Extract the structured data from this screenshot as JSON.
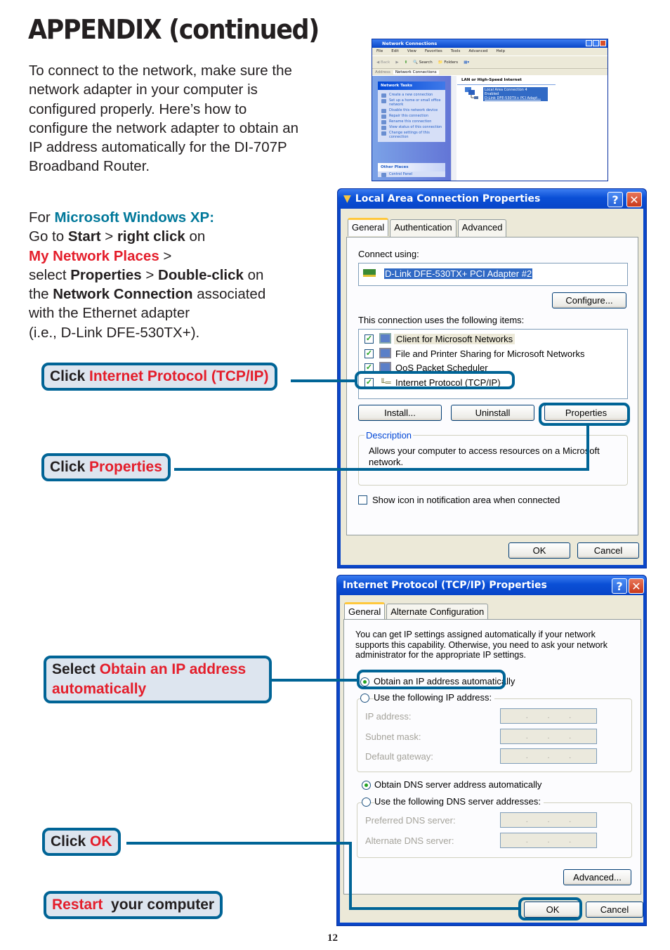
{
  "page": {
    "title": "APPENDIX  (continued)",
    "intro": "To connect to the network, make sure the network adapter in your computer is configured properly. Here’s how to configure the network adapter to obtain an IP address automatically for the DI-707P Broadband Router.",
    "page_number": "12"
  },
  "steps": {
    "for": "For ",
    "os": "Microsoft Windows XP:",
    "goto": "Go to ",
    "start": "Start",
    "gt1": " > ",
    "right_click": "right click",
    "on1": " on",
    "my_network_places": "My Network Places",
    "gt2": " >",
    "select": "select ",
    "properties": "Properties",
    "gt3": " > ",
    "double_click": "Double-click",
    "on2": " on",
    "the": "the ",
    "network_connection": "Network Connection",
    "associated": " associated",
    "with_adapter": "with the Ethernet adapter",
    "example": "(i.e., D-Link DFE-530TX+)."
  },
  "callouts": [
    {
      "prefix": "Click ",
      "highlight": "Internet Protocol (TCP/IP)"
    },
    {
      "prefix": "Click ",
      "highlight": "Properties"
    },
    {
      "prefix": "Select ",
      "highlight": "Obtain an IP address automatically"
    },
    {
      "prefix": "Click ",
      "highlight": "OK"
    },
    {
      "highlight": "Restart",
      "suffix": "  your computer"
    }
  ],
  "network_connections": {
    "title": "Network Connections",
    "menu": [
      "File",
      "Edit",
      "View",
      "Favorites",
      "Tools",
      "Advanced",
      "Help"
    ],
    "toolbar": {
      "back": "Back",
      "search": "Search",
      "folders": "Folders"
    },
    "address_label": "Address",
    "address_value": "Network Connections",
    "network_tasks_header": "Network Tasks",
    "network_tasks": [
      "Create a new connection",
      "Set up a home or small office network",
      "Disable this network device",
      "Repair this connection",
      "Rename this connection",
      "View status of this connection",
      "Change settings of this connection"
    ],
    "other_places_header": "Other Places",
    "other_places": [
      "Control Panel"
    ],
    "group_header": "LAN or High-Speed Internet",
    "connection": {
      "name": "Local Area Connection 4",
      "status": "Enabled",
      "device": "D-Link DFE-530TX+ PCI Adapt..."
    }
  },
  "lan_properties": {
    "title": "Local Area Connection Properties",
    "tabs": [
      "General",
      "Authentication",
      "Advanced"
    ],
    "connect_using_label": "Connect using:",
    "adapter": "D-Link DFE-530TX+ PCI Adapter #2",
    "configure_button": "Configure...",
    "items_label": "This connection uses the following items:",
    "items": [
      {
        "label": "Client for Microsoft Networks",
        "checked": true
      },
      {
        "label": "File and Printer Sharing for Microsoft Networks",
        "checked": true
      },
      {
        "label": "QoS Packet Scheduler",
        "checked": true
      },
      {
        "label": "Internet Protocol (TCP/IP)",
        "checked": true
      }
    ],
    "install_button": "Install...",
    "uninstall_button": "Uninstall",
    "properties_button": "Properties",
    "description_label": "Description",
    "description_text": "Allows your computer to access resources on a Microsoft network.",
    "show_icon_label": "Show icon in notification area when connected",
    "show_icon_checked": false,
    "ok_button": "OK",
    "cancel_button": "Cancel"
  },
  "tcpip_properties": {
    "title": "Internet Protocol (TCP/IP) Properties",
    "tabs": [
      "General",
      "Alternate Configuration"
    ],
    "info_text": "You can get IP settings assigned automatically if your network supports this capability. Otherwise, you need to ask your network administrator for the appropriate IP settings.",
    "obtain_ip_auto": "Obtain an IP address automatically",
    "use_following_ip": "Use the following IP address:",
    "ip_address_label": "IP address:",
    "subnet_mask_label": "Subnet mask:",
    "default_gateway_label": "Default gateway:",
    "obtain_dns_auto": "Obtain DNS server address automatically",
    "use_following_dns": "Use the following DNS server addresses:",
    "preferred_dns_label": "Preferred DNS server:",
    "alternate_dns_label": "Alternate DNS server:",
    "ip_selection": "obtain_automatically",
    "dns_selection": "obtain_automatically",
    "advanced_button": "Advanced...",
    "ok_button": "OK",
    "cancel_button": "Cancel"
  },
  "colors": {
    "accent_teal": "#00789a",
    "highlight_red": "#e41e2b",
    "callout_border": "#006496",
    "callout_fill": "#dde5ef"
  }
}
